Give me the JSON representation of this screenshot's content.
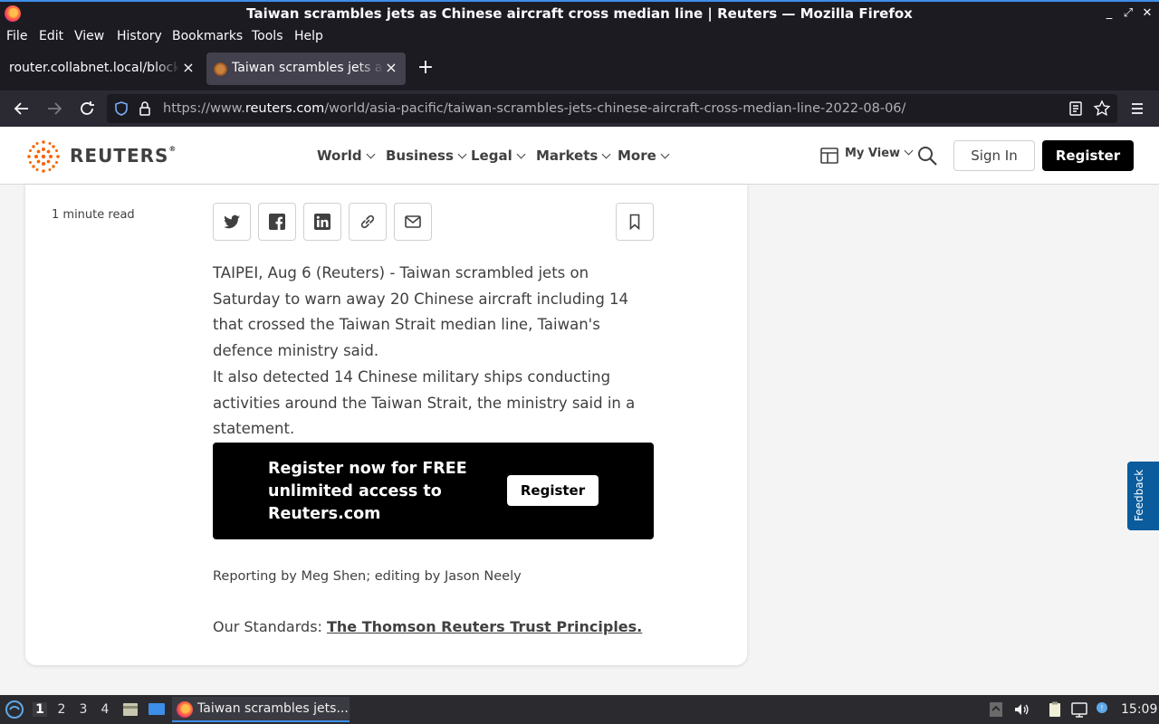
{
  "window": {
    "title": "Taiwan scrambles jets as Chinese aircraft cross median line | Reuters — Mozilla Firefox",
    "controls": [
      "minimize-icon",
      "maximize-icon",
      "close-icon"
    ]
  },
  "menu": {
    "file": "File",
    "edit": "Edit",
    "view": "View",
    "history": "History",
    "bookmarks": "Bookmarks",
    "tools": "Tools",
    "help": "Help"
  },
  "tabs": [
    {
      "label": "router.collabnet.local/blocked",
      "close": "×"
    },
    {
      "label": "Taiwan scrambles jets as Chinese",
      "close": "×"
    }
  ],
  "new_tab": "+",
  "url": {
    "prefix": "https://www.",
    "domain": "reuters.com",
    "path": "/world/asia-pacific/taiwan-scrambles-jets-chinese-aircraft-cross-median-line-2022-08-06/"
  },
  "site": {
    "logo_text": "REUTERS",
    "logo_mark": "®",
    "nav": [
      "World",
      "Business",
      "Legal",
      "Markets",
      "More"
    ],
    "my_view": "My View",
    "sign_in": "Sign In",
    "register": "Register"
  },
  "article": {
    "read_time": "1 minute read",
    "share_icons": [
      "twitter-icon",
      "facebook-icon",
      "linkedin-icon",
      "link-icon",
      "email-icon"
    ],
    "paragraph1": "TAIPEI, Aug 6 (Reuters) - Taiwan scrambled jets on Saturday to warn away 20 Chinese aircraft including 14 that crossed the Taiwan Strait median line, Taiwan's defence ministry said.",
    "paragraph2": "It also detected 14 Chinese military ships conducting activities around the Taiwan Strait, the ministry said in a statement.",
    "promo_text": "Register now for FREE unlimited access to Reuters.com",
    "promo_button": "Register",
    "byline": "Reporting by Meg Shen; editing by Jason Neely",
    "standards_label": "Our Standards: ",
    "standards_link": "The Thomson Reuters Trust Principles."
  },
  "feedback": "Feedback",
  "taskbar": {
    "workspaces": [
      "1",
      "2",
      "3",
      "4"
    ],
    "active_task": "Taiwan scrambles jets...",
    "clock": "15:09"
  },
  "colors": {
    "firefox_dark": "#1c1b22",
    "accent_blue": "#3d8ee8",
    "reuters_orange": "#fa6400",
    "feedback_blue": "#0a5c9c"
  }
}
